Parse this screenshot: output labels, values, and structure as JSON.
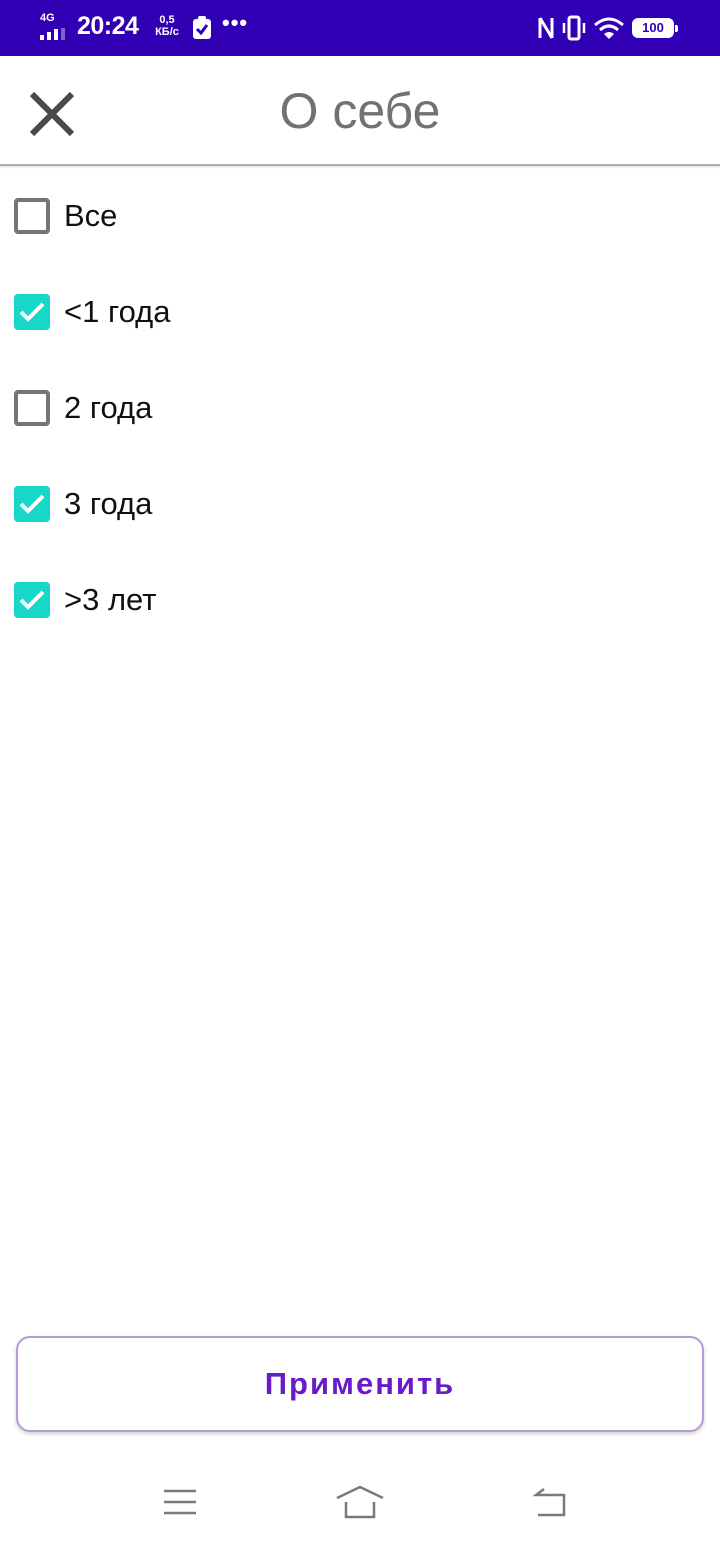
{
  "status_bar": {
    "network": "4G",
    "time": "20:24",
    "speed_value": "0,5",
    "speed_unit": "КБ/с",
    "more": "•••",
    "battery": "100",
    "bg_color": "#3100b5"
  },
  "header": {
    "title": "О себе",
    "close_icon": "close-icon"
  },
  "options": [
    {
      "label": "Все",
      "checked": false
    },
    {
      "label": "<1 года",
      "checked": true
    },
    {
      "label": "2 года",
      "checked": false
    },
    {
      "label": "3 года",
      "checked": true
    },
    {
      "label": ">3 лет",
      "checked": true
    }
  ],
  "apply_button": {
    "label": "Применить"
  },
  "nav_bar": {
    "icons": [
      "menu-icon",
      "home-icon",
      "back-icon"
    ]
  },
  "colors": {
    "accent": "#17d8c8",
    "brand": "#6a1bc9",
    "status_bar": "#3100b5",
    "title_gray": "#727272"
  }
}
